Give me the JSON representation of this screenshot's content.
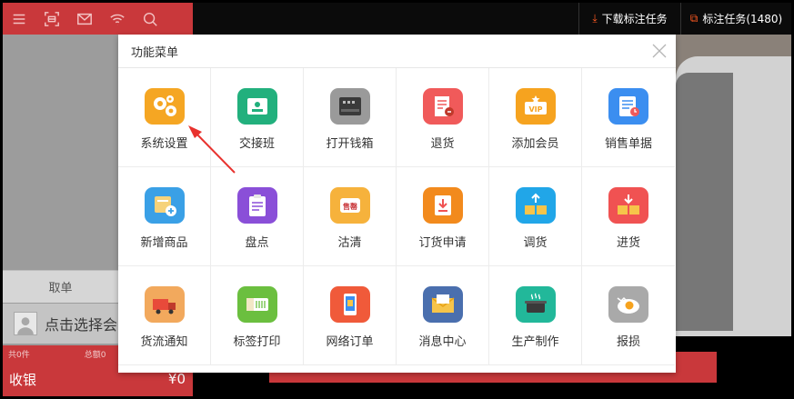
{
  "background": {
    "download_button": "下载标注任务",
    "mark_button": "标注任务(1480)",
    "cancel_label": "取单",
    "member_placeholder": "点击选择会",
    "count_label": "共0件",
    "total_label": "总额0",
    "checkout_label": "收银",
    "checkout_amount": "¥0"
  },
  "dialog": {
    "title": "功能菜单",
    "items": [
      {
        "label": "系统设置",
        "icon": "gears-icon",
        "color": "#f5a623"
      },
      {
        "label": "交接班",
        "icon": "id-card-icon",
        "color": "#22b07d"
      },
      {
        "label": "打开钱箱",
        "icon": "cash-drawer-icon",
        "color": "#9a9a9a"
      },
      {
        "label": "退货",
        "icon": "receipt-return-icon",
        "color": "#f05a5a"
      },
      {
        "label": "添加会员",
        "icon": "vip-card-icon",
        "color": "#f6a31f"
      },
      {
        "label": "销售单据",
        "icon": "sales-document-icon",
        "color": "#3b8ef0"
      },
      {
        "label": "新增商品",
        "icon": "add-product-icon",
        "color": "#3aa0e6"
      },
      {
        "label": "盘点",
        "icon": "clipboard-icon",
        "color": "#8a4fd8"
      },
      {
        "label": "沽清",
        "icon": "sold-out-icon",
        "color": "#f6b23c"
      },
      {
        "label": "订货申请",
        "icon": "order-request-icon",
        "color": "#f28a1d"
      },
      {
        "label": "调货",
        "icon": "transfer-icon",
        "color": "#21a6e8"
      },
      {
        "label": "进货",
        "icon": "stock-in-icon",
        "color": "#f05252"
      },
      {
        "label": "货流通知",
        "icon": "truck-icon",
        "color": "#f2a95d"
      },
      {
        "label": "标签打印",
        "icon": "label-roll-icon",
        "color": "#6bbf3f"
      },
      {
        "label": "网络订单",
        "icon": "mobile-order-icon",
        "color": "#f05a3a"
      },
      {
        "label": "消息中心",
        "icon": "envelope-icon",
        "color": "#4a6fae"
      },
      {
        "label": "生产制作",
        "icon": "cooking-pot-icon",
        "color": "#22b89a"
      },
      {
        "label": "报损",
        "icon": "broken-egg-icon",
        "color": "#a9a9a9"
      }
    ]
  }
}
